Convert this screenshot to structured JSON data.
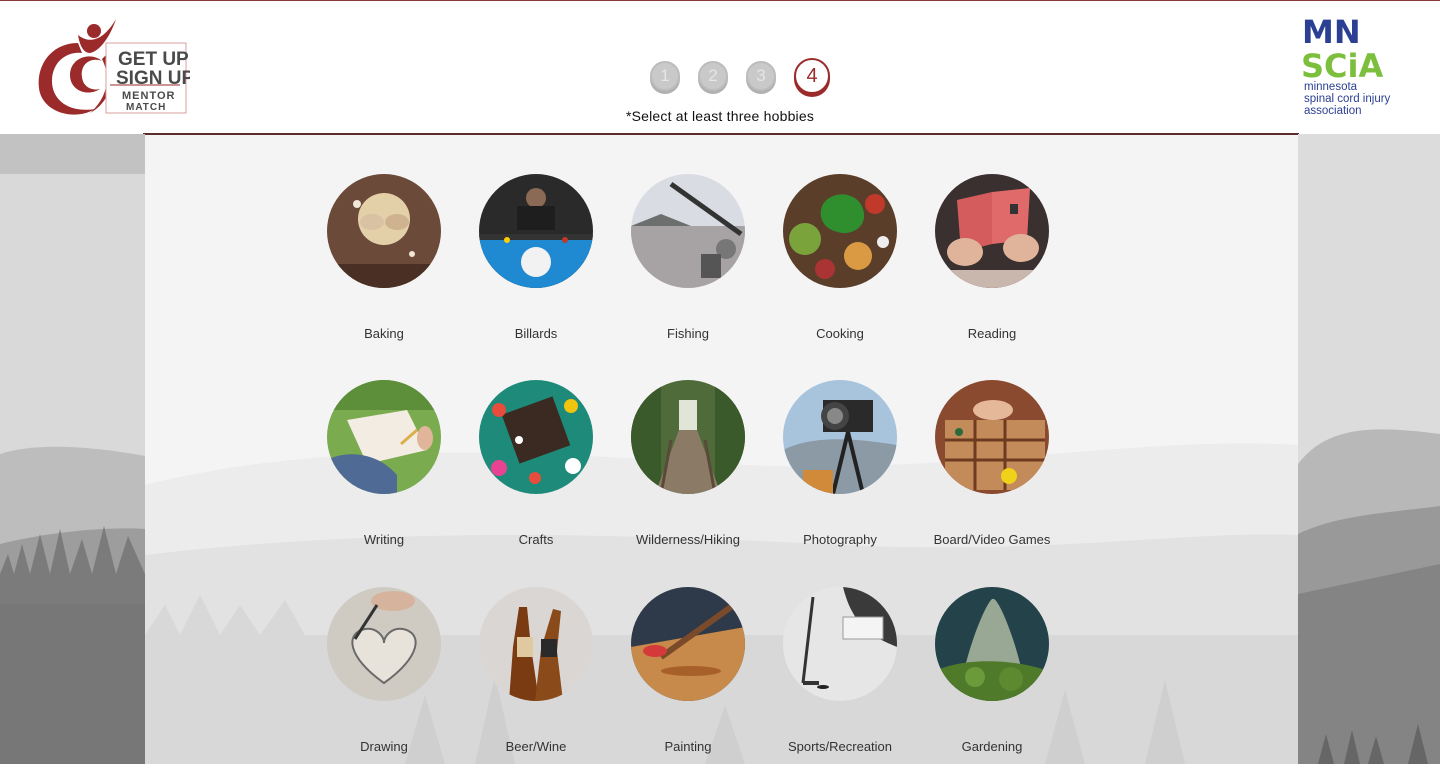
{
  "header": {
    "left_logo": {
      "line1": "GET UP",
      "line2": "SIGN UP",
      "line3": "MENTOR",
      "line4": "MATCH"
    },
    "right_logo": {
      "mn": "MN",
      "scia": "SCiA",
      "line1": "minnesota",
      "line2": "spinal cord injury",
      "line3": "association"
    }
  },
  "steps": [
    {
      "label": "1",
      "active": false
    },
    {
      "label": "2",
      "active": false
    },
    {
      "label": "3",
      "active": false
    },
    {
      "label": "4",
      "active": true
    }
  ],
  "instruction": "*Select at least three hobbies",
  "hobbies": [
    {
      "label": "Baking",
      "icon": "baking-image"
    },
    {
      "label": "Billards",
      "icon": "billiards-image"
    },
    {
      "label": "Fishing",
      "icon": "fishing-image"
    },
    {
      "label": "Cooking",
      "icon": "cooking-image"
    },
    {
      "label": "Reading",
      "icon": "reading-image"
    },
    {
      "label": "Writing",
      "icon": "writing-image"
    },
    {
      "label": "Crafts",
      "icon": "crafts-image"
    },
    {
      "label": "Wilderness/Hiking",
      "icon": "hiking-image"
    },
    {
      "label": "Photography",
      "icon": "photography-image"
    },
    {
      "label": "Board/Video Games",
      "icon": "games-image"
    },
    {
      "label": "Drawing",
      "icon": "drawing-image"
    },
    {
      "label": "Beer/Wine",
      "icon": "beer-wine-image"
    },
    {
      "label": "Painting",
      "icon": "painting-image"
    },
    {
      "label": "Sports/Recreation",
      "icon": "sports-image"
    },
    {
      "label": "Gardening",
      "icon": "gardening-image"
    }
  ],
  "colors": {
    "brand_red": "#9b2a2a",
    "mn_blue": "#2b3f93",
    "scia_green": "#7cbf3c"
  }
}
